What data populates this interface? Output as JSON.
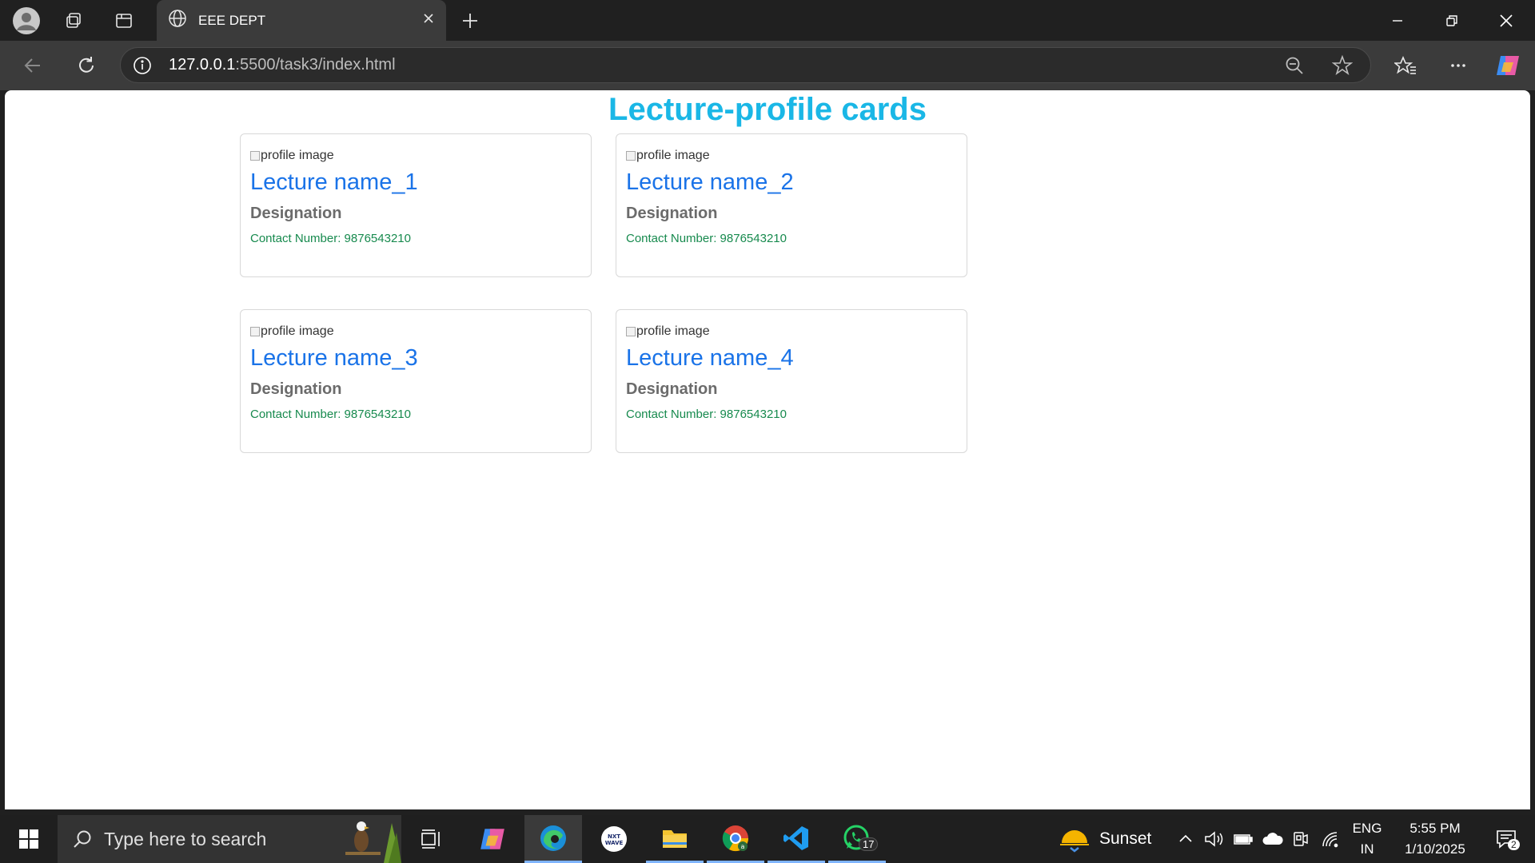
{
  "browser": {
    "tab_title": "EEE DEPT",
    "url_host": "127.0.0.1",
    "url_path": ":5500/task3/index.html"
  },
  "page": {
    "heading": "Lecture-profile cards",
    "cards": [
      {
        "img_alt": "profile image",
        "name": "Lecture name_1",
        "designation": "Designation",
        "contact": "Contact Number: 9876543210"
      },
      {
        "img_alt": "profile image",
        "name": "Lecture name_2",
        "designation": "Designation",
        "contact": "Contact Number: 9876543210"
      },
      {
        "img_alt": "profile image",
        "name": "Lecture name_3",
        "designation": "Designation",
        "contact": "Contact Number: 9876543210"
      },
      {
        "img_alt": "profile image",
        "name": "Lecture name_4",
        "designation": "Designation",
        "contact": "Contact Number: 9876543210"
      }
    ]
  },
  "taskbar": {
    "search_placeholder": "Type here to search",
    "weather": "Sunset",
    "lang_line1": "ENG",
    "lang_line2": "IN",
    "time": "5:55 PM",
    "date": "1/10/2025",
    "whatsapp_badge": "17",
    "notification_count": "2"
  },
  "colors": {
    "heading": "#1ab7e6",
    "name": "#1a73e8",
    "designation": "#6b6b6b",
    "contact": "#178a4e"
  }
}
